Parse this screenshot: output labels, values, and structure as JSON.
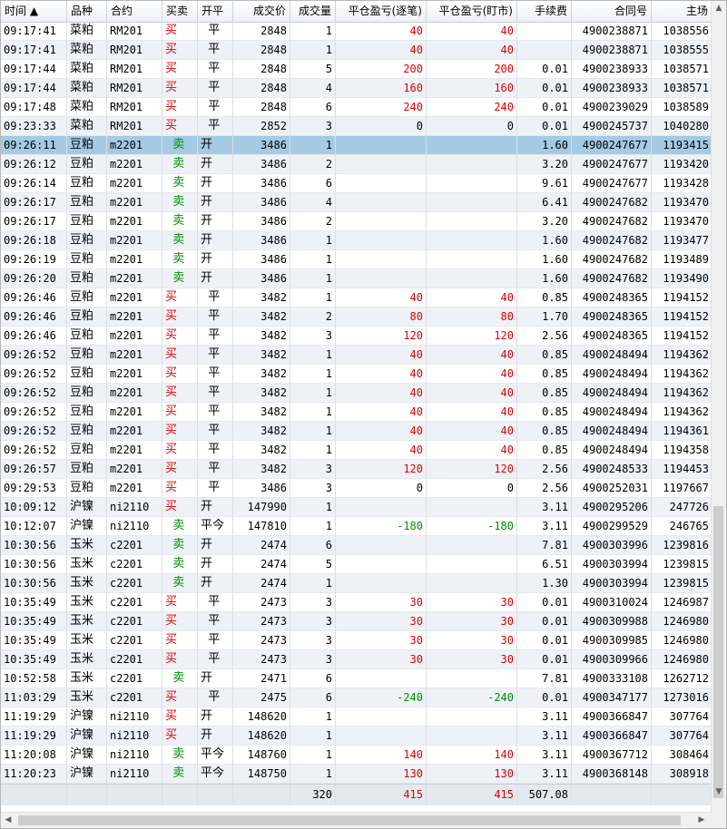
{
  "columns": [
    {
      "key": "time",
      "label": "时间 ▲",
      "w": 73,
      "align": "l",
      "cls": ""
    },
    {
      "key": "product",
      "label": "品种",
      "w": 44,
      "align": "l",
      "cls": "cjk"
    },
    {
      "key": "contract",
      "label": "合约",
      "w": 61,
      "align": "l",
      "cls": ""
    },
    {
      "key": "side",
      "label": "买卖",
      "w": 39,
      "align": "l",
      "cls": "cjk"
    },
    {
      "key": "openclose",
      "label": "开平",
      "w": 39,
      "align": "l",
      "cls": "cjk"
    },
    {
      "key": "price",
      "label": "成交价",
      "w": 63,
      "align": "r",
      "cls": ""
    },
    {
      "key": "volume",
      "label": "成交量",
      "w": 50,
      "align": "r",
      "cls": ""
    },
    {
      "key": "pnl_trade",
      "label": "平仓盈亏(逐笔)",
      "w": 100,
      "align": "r",
      "cls": ""
    },
    {
      "key": "pnl_mtm",
      "label": "平仓盈亏(盯市)",
      "w": 100,
      "align": "r",
      "cls": ""
    },
    {
      "key": "fee",
      "label": "手续费",
      "w": 60,
      "align": "r",
      "cls": ""
    },
    {
      "key": "contract_no",
      "label": "合同号",
      "w": 88,
      "align": "r",
      "cls": ""
    },
    {
      "key": "main_no",
      "label": "主场",
      "w": 67,
      "align": "r",
      "cls": ""
    }
  ],
  "selected_row": 6,
  "rows": [
    [
      "09:17:41",
      "菜粕",
      "RM201",
      "买",
      "  平",
      "2848",
      "1",
      "40",
      "40",
      "",
      "4900238871",
      "1038556"
    ],
    [
      "09:17:41",
      "菜粕",
      "RM201",
      "买",
      "  平",
      "2848",
      "1",
      "40",
      "40",
      "",
      "4900238871",
      "1038555"
    ],
    [
      "09:17:44",
      "菜粕",
      "RM201",
      "买",
      "  平",
      "2848",
      "5",
      "200",
      "200",
      "0.01",
      "4900238933",
      "1038571"
    ],
    [
      "09:17:44",
      "菜粕",
      "RM201",
      "买",
      "  平",
      "2848",
      "4",
      "160",
      "160",
      "0.01",
      "4900238933",
      "1038571"
    ],
    [
      "09:17:48",
      "菜粕",
      "RM201",
      "买",
      "  平",
      "2848",
      "6",
      "240",
      "240",
      "0.01",
      "4900239029",
      "1038589"
    ],
    [
      "09:23:33",
      "菜粕",
      "RM201",
      "买",
      "  平",
      "2852",
      "3",
      "0",
      "0",
      "0.01",
      "4900245737",
      "1040280"
    ],
    [
      "09:26:11",
      "豆粕",
      "m2201",
      "  卖",
      "开",
      "3486",
      "1",
      "",
      "",
      "1.60",
      "4900247677",
      "1193415"
    ],
    [
      "09:26:12",
      "豆粕",
      "m2201",
      "  卖",
      "开",
      "3486",
      "2",
      "",
      "",
      "3.20",
      "4900247677",
      "1193420"
    ],
    [
      "09:26:14",
      "豆粕",
      "m2201",
      "  卖",
      "开",
      "3486",
      "6",
      "",
      "",
      "9.61",
      "4900247677",
      "1193428"
    ],
    [
      "09:26:17",
      "豆粕",
      "m2201",
      "  卖",
      "开",
      "3486",
      "4",
      "",
      "",
      "6.41",
      "4900247682",
      "1193470"
    ],
    [
      "09:26:17",
      "豆粕",
      "m2201",
      "  卖",
      "开",
      "3486",
      "2",
      "",
      "",
      "3.20",
      "4900247682",
      "1193470"
    ],
    [
      "09:26:18",
      "豆粕",
      "m2201",
      "  卖",
      "开",
      "3486",
      "1",
      "",
      "",
      "1.60",
      "4900247682",
      "1193477"
    ],
    [
      "09:26:19",
      "豆粕",
      "m2201",
      "  卖",
      "开",
      "3486",
      "1",
      "",
      "",
      "1.60",
      "4900247682",
      "1193489"
    ],
    [
      "09:26:20",
      "豆粕",
      "m2201",
      "  卖",
      "开",
      "3486",
      "1",
      "",
      "",
      "1.60",
      "4900247682",
      "1193490"
    ],
    [
      "09:26:46",
      "豆粕",
      "m2201",
      "买",
      "  平",
      "3482",
      "1",
      "40",
      "40",
      "0.85",
      "4900248365",
      "1194152"
    ],
    [
      "09:26:46",
      "豆粕",
      "m2201",
      "买",
      "  平",
      "3482",
      "2",
      "80",
      "80",
      "1.70",
      "4900248365",
      "1194152"
    ],
    [
      "09:26:46",
      "豆粕",
      "m2201",
      "买",
      "  平",
      "3482",
      "3",
      "120",
      "120",
      "2.56",
      "4900248365",
      "1194152"
    ],
    [
      "09:26:52",
      "豆粕",
      "m2201",
      "买",
      "  平",
      "3482",
      "1",
      "40",
      "40",
      "0.85",
      "4900248494",
      "1194362"
    ],
    [
      "09:26:52",
      "豆粕",
      "m2201",
      "买",
      "  平",
      "3482",
      "1",
      "40",
      "40",
      "0.85",
      "4900248494",
      "1194362"
    ],
    [
      "09:26:52",
      "豆粕",
      "m2201",
      "买",
      "  平",
      "3482",
      "1",
      "40",
      "40",
      "0.85",
      "4900248494",
      "1194362"
    ],
    [
      "09:26:52",
      "豆粕",
      "m2201",
      "买",
      "  平",
      "3482",
      "1",
      "40",
      "40",
      "0.85",
      "4900248494",
      "1194362"
    ],
    [
      "09:26:52",
      "豆粕",
      "m2201",
      "买",
      "  平",
      "3482",
      "1",
      "40",
      "40",
      "0.85",
      "4900248494",
      "1194361"
    ],
    [
      "09:26:52",
      "豆粕",
      "m2201",
      "买",
      "  平",
      "3482",
      "1",
      "40",
      "40",
      "0.85",
      "4900248494",
      "1194358"
    ],
    [
      "09:26:57",
      "豆粕",
      "m2201",
      "买",
      "  平",
      "3482",
      "3",
      "120",
      "120",
      "2.56",
      "4900248533",
      "1194453"
    ],
    [
      "09:29:53",
      "豆粕",
      "m2201",
      "买",
      "  平",
      "3486",
      "3",
      "0",
      "0",
      "2.56",
      "4900252031",
      "1197667"
    ],
    [
      "10:09:12",
      "沪镍",
      "ni2110",
      "买",
      "开",
      "147990",
      "1",
      "",
      "",
      "3.11",
      "4900295206",
      "247726"
    ],
    [
      "10:12:07",
      "沪镍",
      "ni2110",
      "  卖",
      "平今",
      "147810",
      "1",
      "-180",
      "-180",
      "3.11",
      "4900299529",
      "246765"
    ],
    [
      "10:30:56",
      "玉米",
      "c2201",
      "  卖",
      "开",
      "2474",
      "6",
      "",
      "",
      "7.81",
      "4900303996",
      "1239816"
    ],
    [
      "10:30:56",
      "玉米",
      "c2201",
      "  卖",
      "开",
      "2474",
      "5",
      "",
      "",
      "6.51",
      "4900303994",
      "1239815"
    ],
    [
      "10:30:56",
      "玉米",
      "c2201",
      "  卖",
      "开",
      "2474",
      "1",
      "",
      "",
      "1.30",
      "4900303994",
      "1239815"
    ],
    [
      "10:35:49",
      "玉米",
      "c2201",
      "买",
      "  平",
      "2473",
      "3",
      "30",
      "30",
      "0.01",
      "4900310024",
      "1246987"
    ],
    [
      "10:35:49",
      "玉米",
      "c2201",
      "买",
      "  平",
      "2473",
      "3",
      "30",
      "30",
      "0.01",
      "4900309988",
      "1246980"
    ],
    [
      "10:35:49",
      "玉米",
      "c2201",
      "买",
      "  平",
      "2473",
      "3",
      "30",
      "30",
      "0.01",
      "4900309985",
      "1246980"
    ],
    [
      "10:35:49",
      "玉米",
      "c2201",
      "买",
      "  平",
      "2473",
      "3",
      "30",
      "30",
      "0.01",
      "4900309966",
      "1246980"
    ],
    [
      "10:52:58",
      "玉米",
      "c2201",
      "  卖",
      "开",
      "2471",
      "6",
      "",
      "",
      "7.81",
      "4900333108",
      "1262712"
    ],
    [
      "11:03:29",
      "玉米",
      "c2201",
      "买",
      "  平",
      "2475",
      "6",
      "-240",
      "-240",
      "0.01",
      "4900347177",
      "1273016"
    ],
    [
      "11:19:29",
      "沪镍",
      "ni2110",
      "买",
      "开",
      "148620",
      "1",
      "",
      "",
      "3.11",
      "4900366847",
      "307764"
    ],
    [
      "11:19:29",
      "沪镍",
      "ni2110",
      "买",
      "开",
      "148620",
      "1",
      "",
      "",
      "3.11",
      "4900366847",
      "307764"
    ],
    [
      "11:20:08",
      "沪镍",
      "ni2110",
      "  卖",
      "平今",
      "148760",
      "1",
      "140",
      "140",
      "3.11",
      "4900367712",
      "308464"
    ],
    [
      "11:20:23",
      "沪镍",
      "ni2110",
      "  卖",
      "平今",
      "148750",
      "1",
      "130",
      "130",
      "3.11",
      "4900368148",
      "308918"
    ]
  ],
  "totals": [
    "",
    "",
    "",
    "",
    "",
    "",
    "320",
    "415",
    "415",
    "507.08",
    "",
    ""
  ],
  "colors": {
    "buy": "#e00000",
    "sell": "#009000",
    "profit": "#e00000",
    "loss": "#009000"
  }
}
